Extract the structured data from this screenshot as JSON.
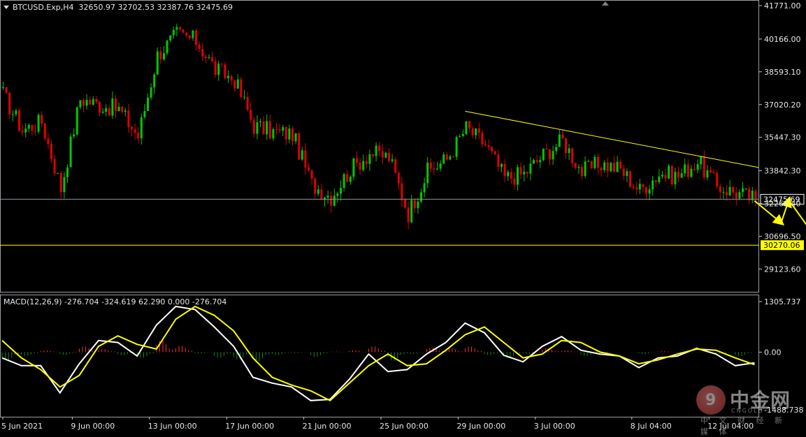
{
  "header": {
    "symbol": "BTCUSD.Exp,H4",
    "ohlc": "32650.97 32702.53 32387.76 32475.69"
  },
  "macd_header": "MACD(12,26,9) -276.704 -324.619 62.290 0.000 -276.704",
  "logo": {
    "name": "中金网",
    "sub": "中 文 财 经 新 媒 体",
    "en": "CNGOLD"
  },
  "colors": {
    "background": "#000000",
    "bull_candle": "#00c800",
    "bear_candle": "#e00000",
    "trendline": "#ffff00",
    "arrows": "#ffff00",
    "current_price_line": "#8c96a0",
    "support_line": "#ffff00",
    "macd_white": "#ffffff",
    "macd_signal": "#ffff00",
    "hist_positive": "#ff3030",
    "hist_negative": "#1a8a1a",
    "axis_text": "#e8e8e8"
  },
  "chart_data": [
    {
      "type": "candlestick",
      "title": "BTCUSD.Exp,H4",
      "timeframe": "H4",
      "ylim": [
        28300,
        41771
      ],
      "y_ticks": [
        "41771.00",
        "40166.00",
        "38593.10",
        "37020.20",
        "35447.30",
        "33842.30",
        "32269.40",
        "30696.50",
        "29123.60"
      ],
      "x_tick_labels": [
        "5 Jun 2021",
        "9 Jun 00:00",
        "13 Jun 00:00",
        "17 Jun 00:00",
        "21 Jun 00:00",
        "25 Jun 00:00",
        "29 Jun 00:00",
        "3 Jul 00:00",
        "8 Jul 04:00",
        "12 Jul 04:00"
      ],
      "current_price": 32475.69,
      "current_price_label": "32475.69",
      "support_level": 30270.06,
      "support_label": "30270.06",
      "close_path": [
        {
          "date": "2021-06-05",
          "price": 37500
        },
        {
          "date": "2021-06-06",
          "price": 35800
        },
        {
          "date": "2021-06-07",
          "price": 36200
        },
        {
          "date": "2021-06-08",
          "price": 33000
        },
        {
          "date": "2021-06-09",
          "price": 37300
        },
        {
          "date": "2021-06-10",
          "price": 37000
        },
        {
          "date": "2021-06-11",
          "price": 36800
        },
        {
          "date": "2021-06-12",
          "price": 35500
        },
        {
          "date": "2021-06-13",
          "price": 39400
        },
        {
          "date": "2021-06-14",
          "price": 40400
        },
        {
          "date": "2021-06-15",
          "price": 40100
        },
        {
          "date": "2021-06-16",
          "price": 38700
        },
        {
          "date": "2021-06-17",
          "price": 38200
        },
        {
          "date": "2021-06-18",
          "price": 36000
        },
        {
          "date": "2021-06-19",
          "price": 35700
        },
        {
          "date": "2021-06-20",
          "price": 35600
        },
        {
          "date": "2021-06-21",
          "price": 33200
        },
        {
          "date": "2021-06-22",
          "price": 32600
        },
        {
          "date": "2021-06-23",
          "price": 33900
        },
        {
          "date": "2021-06-24",
          "price": 34700
        },
        {
          "date": "2021-06-25",
          "price": 34500
        },
        {
          "date": "2021-06-26",
          "price": 31800
        },
        {
          "date": "2021-06-27",
          "price": 33800
        },
        {
          "date": "2021-06-28",
          "price": 34400
        },
        {
          "date": "2021-06-29",
          "price": 35900
        },
        {
          "date": "2021-06-30",
          "price": 35100
        },
        {
          "date": "2021-07-01",
          "price": 33500
        },
        {
          "date": "2021-07-02",
          "price": 33700
        },
        {
          "date": "2021-07-03",
          "price": 34600
        },
        {
          "date": "2021-07-04",
          "price": 35300
        },
        {
          "date": "2021-07-05",
          "price": 33800
        },
        {
          "date": "2021-07-06",
          "price": 34200
        },
        {
          "date": "2021-07-07",
          "price": 33900
        },
        {
          "date": "2021-07-08",
          "price": 32900
        },
        {
          "date": "2021-07-09",
          "price": 33700
        },
        {
          "date": "2021-07-10",
          "price": 33600
        },
        {
          "date": "2021-07-11",
          "price": 34300
        },
        {
          "date": "2021-07-12",
          "price": 33100
        },
        {
          "date": "2021-07-13",
          "price": 32800
        },
        {
          "date": "2021-07-14",
          "price": 32475.69
        }
      ],
      "trendline": {
        "from": {
          "date": "2021-06-29",
          "price": 36700
        },
        "to": {
          "date": "2021-07-17",
          "price": 34000
        }
      },
      "forecast_arrows": [
        {
          "from": {
            "date": "2021-07-14",
            "price": 32400
          },
          "to": {
            "date": "2021-07-15",
            "price": 31300
          }
        },
        {
          "from": {
            "date": "2021-07-15",
            "price": 31300
          },
          "to": {
            "date": "2021-07-15",
            "price": 32500
          }
        },
        {
          "from": {
            "date": "2021-07-15",
            "price": 32500
          },
          "to": {
            "date": "2021-07-16",
            "price": 30270
          }
        }
      ]
    },
    {
      "type": "line",
      "title": "MACD(12,26,9)",
      "ylim": [
        -1488.738,
        1305.737
      ],
      "y_ticks": [
        "1305.737",
        "0.00",
        "-1488.738"
      ],
      "macd_path": [
        {
          "date": "2021-06-05",
          "value": -150
        },
        {
          "date": "2021-06-06",
          "value": -350
        },
        {
          "date": "2021-06-07",
          "value": -350
        },
        {
          "date": "2021-06-08",
          "value": -1050
        },
        {
          "date": "2021-06-09",
          "value": -300
        },
        {
          "date": "2021-06-10",
          "value": 300
        },
        {
          "date": "2021-06-11",
          "value": 250
        },
        {
          "date": "2021-06-12",
          "value": -100
        },
        {
          "date": "2021-06-13",
          "value": 700
        },
        {
          "date": "2021-06-14",
          "value": 1180
        },
        {
          "date": "2021-06-15",
          "value": 1100
        },
        {
          "date": "2021-06-16",
          "value": 650
        },
        {
          "date": "2021-06-17",
          "value": 150
        },
        {
          "date": "2021-06-18",
          "value": -650
        },
        {
          "date": "2021-06-19",
          "value": -800
        },
        {
          "date": "2021-06-20",
          "value": -900
        },
        {
          "date": "2021-06-21",
          "value": -1250
        },
        {
          "date": "2021-06-22",
          "value": -1220
        },
        {
          "date": "2021-06-23",
          "value": -700
        },
        {
          "date": "2021-06-24",
          "value": -50
        },
        {
          "date": "2021-06-25",
          "value": -500
        },
        {
          "date": "2021-06-26",
          "value": -450
        },
        {
          "date": "2021-06-27",
          "value": -50
        },
        {
          "date": "2021-06-28",
          "value": 250
        },
        {
          "date": "2021-06-29",
          "value": 750
        },
        {
          "date": "2021-06-30",
          "value": 500
        },
        {
          "date": "2021-07-01",
          "value": -80
        },
        {
          "date": "2021-07-02",
          "value": -250
        },
        {
          "date": "2021-07-03",
          "value": 150
        },
        {
          "date": "2021-07-04",
          "value": 400
        },
        {
          "date": "2021-07-05",
          "value": 50
        },
        {
          "date": "2021-07-06",
          "value": -50
        },
        {
          "date": "2021-07-07",
          "value": -100
        },
        {
          "date": "2021-07-08",
          "value": -400
        },
        {
          "date": "2021-07-09",
          "value": -150
        },
        {
          "date": "2021-07-10",
          "value": -100
        },
        {
          "date": "2021-07-11",
          "value": 100
        },
        {
          "date": "2021-07-12",
          "value": -50
        },
        {
          "date": "2021-07-13",
          "value": -350
        },
        {
          "date": "2021-07-14",
          "value": -276.704
        }
      ],
      "signal_path": [
        {
          "date": "2021-06-05",
          "value": 300
        },
        {
          "date": "2021-06-06",
          "value": -150
        },
        {
          "date": "2021-06-07",
          "value": -450
        },
        {
          "date": "2021-06-08",
          "value": -900
        },
        {
          "date": "2021-06-09",
          "value": -600
        },
        {
          "date": "2021-06-10",
          "value": 150
        },
        {
          "date": "2021-06-11",
          "value": 420
        },
        {
          "date": "2021-06-12",
          "value": 200
        },
        {
          "date": "2021-06-13",
          "value": 80
        },
        {
          "date": "2021-06-14",
          "value": 850
        },
        {
          "date": "2021-06-15",
          "value": 1180
        },
        {
          "date": "2021-06-16",
          "value": 950
        },
        {
          "date": "2021-06-17",
          "value": 550
        },
        {
          "date": "2021-06-18",
          "value": -150
        },
        {
          "date": "2021-06-19",
          "value": -650
        },
        {
          "date": "2021-06-20",
          "value": -850
        },
        {
          "date": "2021-06-21",
          "value": -1000
        },
        {
          "date": "2021-06-22",
          "value": -1250
        },
        {
          "date": "2021-06-23",
          "value": -800
        },
        {
          "date": "2021-06-24",
          "value": -350
        },
        {
          "date": "2021-06-25",
          "value": -50
        },
        {
          "date": "2021-06-26",
          "value": -350
        },
        {
          "date": "2021-06-27",
          "value": -300
        },
        {
          "date": "2021-06-28",
          "value": 50
        },
        {
          "date": "2021-06-29",
          "value": 450
        },
        {
          "date": "2021-06-30",
          "value": 650
        },
        {
          "date": "2021-07-01",
          "value": 250
        },
        {
          "date": "2021-07-02",
          "value": -150
        },
        {
          "date": "2021-07-03",
          "value": -50
        },
        {
          "date": "2021-07-04",
          "value": 300
        },
        {
          "date": "2021-07-05",
          "value": 250
        },
        {
          "date": "2021-07-06",
          "value": 0
        },
        {
          "date": "2021-07-07",
          "value": -100
        },
        {
          "date": "2021-07-08",
          "value": -300
        },
        {
          "date": "2021-07-09",
          "value": -200
        },
        {
          "date": "2021-07-10",
          "value": -50
        },
        {
          "date": "2021-07-11",
          "value": 80
        },
        {
          "date": "2021-07-12",
          "value": 50
        },
        {
          "date": "2021-07-13",
          "value": -150
        },
        {
          "date": "2021-07-14",
          "value": -324.619
        }
      ]
    }
  ]
}
